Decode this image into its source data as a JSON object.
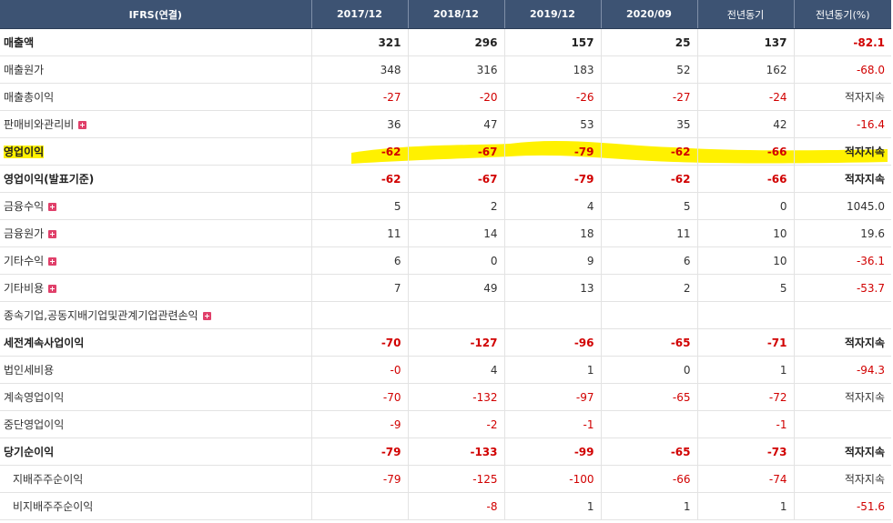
{
  "headers": [
    "IFRS(연결)",
    "2017/12",
    "2018/12",
    "2019/12",
    "2020/09",
    "전년동기",
    "전년동기(%)"
  ],
  "rows": [
    {
      "label": "매출액",
      "values": [
        "321",
        "296",
        "157",
        "25",
        "137",
        "-82.1"
      ],
      "bold": true,
      "plus": false
    },
    {
      "label": "매출원가",
      "values": [
        "348",
        "316",
        "183",
        "52",
        "162",
        "-68.0"
      ],
      "bold": false,
      "plus": false
    },
    {
      "label": "매출총이익",
      "values": [
        "-27",
        "-20",
        "-26",
        "-27",
        "-24",
        "적자지속"
      ],
      "bold": false,
      "plus": false
    },
    {
      "label": "판매비와관리비",
      "values": [
        "36",
        "47",
        "53",
        "35",
        "42",
        "-16.4"
      ],
      "bold": false,
      "plus": true
    },
    {
      "label": "영업이익",
      "values": [
        "-62",
        "-67",
        "-79",
        "-62",
        "-66",
        "적자지속"
      ],
      "bold": true,
      "plus": false,
      "highlight": true
    },
    {
      "label": "영업이익(발표기준)",
      "values": [
        "-62",
        "-67",
        "-79",
        "-62",
        "-66",
        "적자지속"
      ],
      "bold": true,
      "plus": false
    },
    {
      "label": "금융수익",
      "values": [
        "5",
        "2",
        "4",
        "5",
        "0",
        "1045.0"
      ],
      "bold": false,
      "plus": true
    },
    {
      "label": "금융원가",
      "values": [
        "11",
        "14",
        "18",
        "11",
        "10",
        "19.6"
      ],
      "bold": false,
      "plus": true
    },
    {
      "label": "기타수익",
      "values": [
        "6",
        "0",
        "9",
        "6",
        "10",
        "-36.1"
      ],
      "bold": false,
      "plus": true
    },
    {
      "label": "기타비용",
      "values": [
        "7",
        "49",
        "13",
        "2",
        "5",
        "-53.7"
      ],
      "bold": false,
      "plus": true
    },
    {
      "label": "종속기업,공동지배기업및관계기업관련손익",
      "values": [
        "",
        "",
        "",
        "",
        "",
        ""
      ],
      "bold": false,
      "plus": true,
      "span": true
    },
    {
      "label": "세전계속사업이익",
      "values": [
        "-70",
        "-127",
        "-96",
        "-65",
        "-71",
        "적자지속"
      ],
      "bold": true,
      "plus": false
    },
    {
      "label": "법인세비용",
      "values": [
        "-0",
        "4",
        "1",
        "0",
        "1",
        "-94.3"
      ],
      "bold": false,
      "plus": false
    },
    {
      "label": "계속영업이익",
      "values": [
        "-70",
        "-132",
        "-97",
        "-65",
        "-72",
        "적자지속"
      ],
      "bold": false,
      "plus": false
    },
    {
      "label": "중단영업이익",
      "values": [
        "-9",
        "-2",
        "-1",
        "",
        "-1",
        ""
      ],
      "bold": false,
      "plus": false
    },
    {
      "label": "당기순이익",
      "values": [
        "-79",
        "-133",
        "-99",
        "-65",
        "-73",
        "적자지속"
      ],
      "bold": true,
      "plus": false
    },
    {
      "label": "지배주주순이익",
      "values": [
        "-79",
        "-125",
        "-100",
        "-66",
        "-74",
        "적자지속"
      ],
      "bold": false,
      "plus": false,
      "indent": true
    },
    {
      "label": "비지배주주순이익",
      "values": [
        "",
        "-8",
        "1",
        "1",
        "1",
        "-51.6"
      ],
      "bold": false,
      "plus": false,
      "indent": true
    }
  ],
  "colors": {
    "header_bg": "#3d5373",
    "negative": "#d10000",
    "highlight": "#fff100"
  },
  "icons": {
    "expand": "plus-square-icon"
  }
}
